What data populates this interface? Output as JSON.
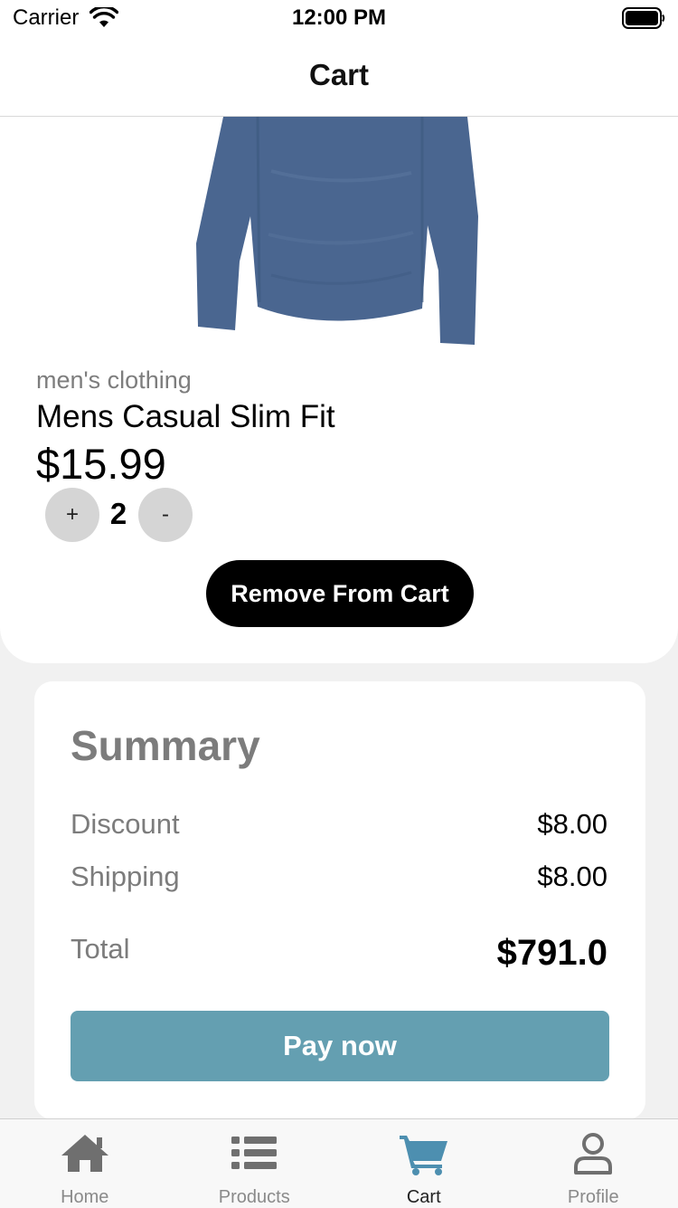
{
  "status_bar": {
    "carrier": "Carrier",
    "time": "12:00 PM"
  },
  "nav": {
    "title": "Cart"
  },
  "product": {
    "category": "men's clothing",
    "title": "Mens Casual Slim Fit",
    "price": "$15.99",
    "quantity": "2",
    "plus_label": "+",
    "minus_label": "-",
    "remove_label": "Remove From Cart",
    "image_color": "#4a6690"
  },
  "summary": {
    "title": "Summary",
    "discount_label": "Discount",
    "discount_value": "$8.00",
    "shipping_label": "Shipping",
    "shipping_value": "$8.00",
    "total_label": "Total",
    "total_value": "$791.0",
    "pay_label": "Pay now"
  },
  "tabs": [
    {
      "label": "Home",
      "icon": "home-icon",
      "active": false
    },
    {
      "label": "Products",
      "icon": "list-icon",
      "active": false
    },
    {
      "label": "Cart",
      "icon": "cart-icon",
      "active": true
    },
    {
      "label": "Profile",
      "icon": "user-icon",
      "active": false
    }
  ],
  "colors": {
    "accent": "#649fb1",
    "active_tab_icon": "#4d8fb0",
    "inactive_tab_icon": "#6f6f6f"
  }
}
